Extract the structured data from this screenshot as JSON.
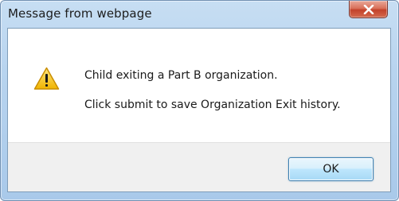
{
  "dialog": {
    "title": "Message from webpage",
    "close_icon": "close-icon",
    "icon": "warning-icon",
    "message_lines": [
      "Child exiting a Part B organization.",
      "Click submit to save Organization Exit history."
    ],
    "ok_label": "OK"
  },
  "colors": {
    "title_bar": "#b8d4ef",
    "close_button": "#c2412a",
    "warning_fill": "#f5c400",
    "ok_button_border": "#3c7fb1"
  }
}
